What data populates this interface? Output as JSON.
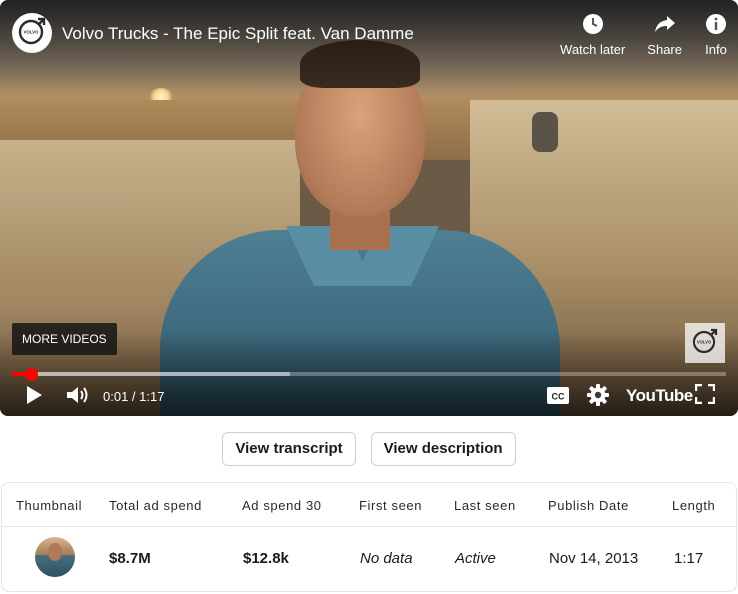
{
  "player": {
    "title": "Volvo Trucks - The Epic Split feat. Van Damme",
    "channel_logo_icon": "volvo-logo-icon",
    "top_actions": [
      {
        "label": "Watch later",
        "icon": "clock-icon"
      },
      {
        "label": "Share",
        "icon": "share-arrow-icon"
      },
      {
        "label": "Info",
        "icon": "info-icon"
      }
    ],
    "more_videos": "MORE VIDEOS",
    "time": "0:01 / 1:17",
    "progress_played_fraction": 0.026,
    "progress_buffered_fraction": 0.39,
    "accent_color": "#ff0000",
    "brand": "YouTube"
  },
  "buttons": {
    "transcript": "View transcript",
    "description": "View description"
  },
  "table": {
    "headers": [
      "Thumbnail",
      "Total ad spend",
      "Ad spend 30",
      "First seen",
      "Last seen",
      "Publish Date",
      "Length"
    ],
    "row": {
      "total_ad_spend": "$8.7M",
      "ad_spend_30": "$12.8k",
      "first_seen": "No data",
      "last_seen": "Active",
      "publish_date": "Nov 14, 2013",
      "length": "1:17"
    }
  }
}
